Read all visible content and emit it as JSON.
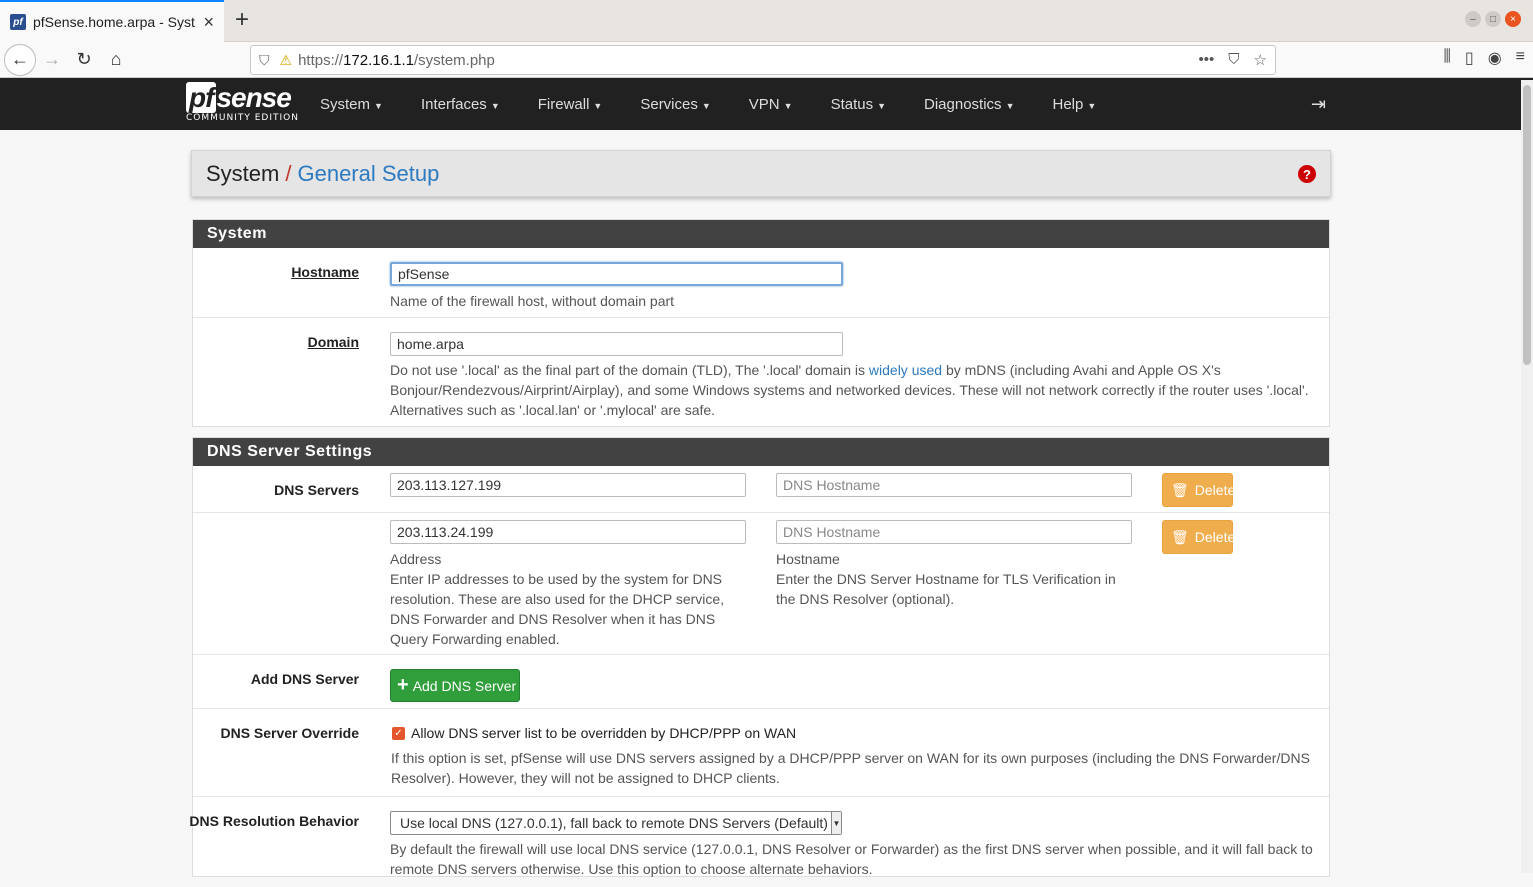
{
  "browser": {
    "tab_title": "pfSense.home.arpa - Syst",
    "favicon_text": "pf",
    "url_prefix": "https://",
    "url_host": "172.16.1.1",
    "url_path": "/system.php"
  },
  "header": {
    "logo_main": "sense",
    "logo_pf": "pf",
    "logo_sub": "COMMUNITY EDITION",
    "menu": [
      "System",
      "Interfaces",
      "Firewall",
      "Services",
      "VPN",
      "Status",
      "Diagnostics",
      "Help"
    ]
  },
  "breadcrumb": {
    "parent": "System",
    "separator": "/",
    "current": "General Setup"
  },
  "system_panel": {
    "title": "System",
    "hostname_label": "Hostname",
    "hostname_value": "pfSense",
    "hostname_help": "Name of the firewall host, without domain part",
    "domain_label": "Domain",
    "domain_value": "home.arpa",
    "domain_help_1": "Do not use '.local' as the final part of the domain (TLD), The '.local' domain is ",
    "domain_help_link": "widely used",
    "domain_help_2": " by mDNS (including Avahi and Apple OS X's Bonjour/Rendezvous/Airprint/Airplay), and some Windows systems and networked devices. These will not network correctly if the router uses '.local'. Alternatives such as '.local.lan' or '.mylocal' are safe."
  },
  "dns_panel": {
    "title": "DNS Server Settings",
    "servers_label": "DNS Servers",
    "servers": [
      {
        "address": "203.113.127.199",
        "hostname_placeholder": "DNS Hostname",
        "delete_label": "Delete"
      },
      {
        "address": "203.113.24.199",
        "hostname_placeholder": "DNS Hostname",
        "delete_label": "Delete"
      }
    ],
    "address_caption": "Address",
    "address_help": "Enter IP addresses to be used by the system for DNS resolution. These are also used for the DHCP service, DNS Forwarder and DNS Resolver when it has DNS Query Forwarding enabled.",
    "hostname_caption": "Hostname",
    "hostname_help": "Enter the DNS Server Hostname for TLS Verification in the DNS Resolver (optional).",
    "add_label": "Add DNS Server",
    "add_button": "Add DNS Server",
    "override_label": "DNS Server Override",
    "override_checked": true,
    "override_text": "Allow DNS server list to be overridden by DHCP/PPP on WAN",
    "override_help": "If this option is set, pfSense will use DNS servers assigned by a DHCP/PPP server on WAN for its own purposes (including the DNS Forwarder/DNS Resolver). However, they will not be assigned to DHCP clients.",
    "behavior_label": "DNS Resolution Behavior",
    "behavior_value": "Use local DNS (127.0.0.1), fall back to remote DNS Servers (Default)",
    "behavior_help": "By default the firewall will use local DNS service (127.0.0.1, DNS Resolver or Forwarder) as the first DNS server when possible, and it will fall back to remote DNS servers otherwise. Use this option to choose alternate behaviors."
  }
}
